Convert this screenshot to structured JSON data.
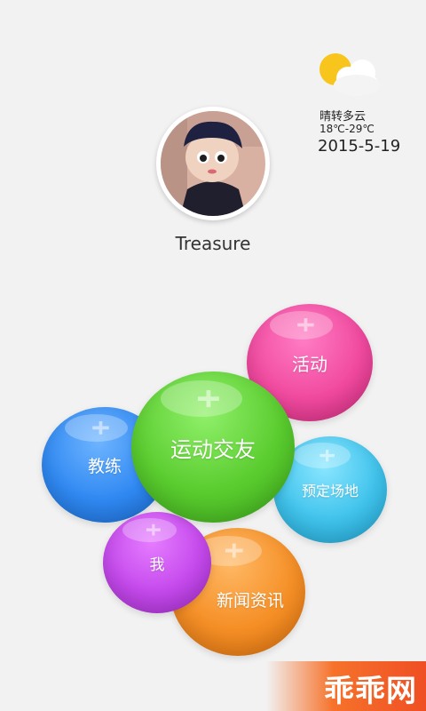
{
  "weather": {
    "icon": "partly-cloudy-icon",
    "description": "晴转多云",
    "temperature": "18℃-29℃",
    "date": "2015-5-19"
  },
  "profile": {
    "avatar_icon": "user-avatar",
    "name": "Treasure"
  },
  "menu": {
    "activity": "活动",
    "social": "运动交友",
    "coach": "教练",
    "book_venue": "预定场地",
    "me": "我",
    "news": "新闻资讯"
  },
  "colors": {
    "activity": "#f14a9f",
    "social": "#5acc2f",
    "coach": "#3089f2",
    "book_venue": "#40c3ec",
    "me": "#c549ec",
    "news": "#f58f26",
    "watermark": "#ef4f23"
  },
  "watermark": {
    "text": "乖乖网"
  }
}
